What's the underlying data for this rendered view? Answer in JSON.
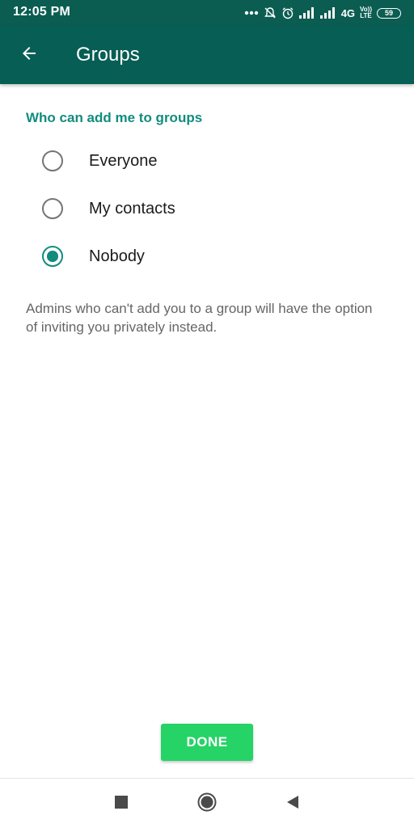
{
  "status_bar": {
    "time": "12:05 PM",
    "network": "4G",
    "volte_top": "Vo))",
    "volte_bottom": "LTE",
    "battery": "59"
  },
  "app_bar": {
    "title": "Groups",
    "back_icon": "arrow-left-icon"
  },
  "settings": {
    "section_header": "Who can add me to groups",
    "options": [
      {
        "label": "Everyone",
        "selected": false
      },
      {
        "label": "My contacts",
        "selected": false
      },
      {
        "label": "Nobody",
        "selected": true
      }
    ],
    "description": "Admins who can't add you to a group will have the option of inviting you privately instead."
  },
  "done_button": {
    "label": "DONE"
  },
  "nav_bar": {
    "icons": [
      "recents-square-icon",
      "home-circle-icon",
      "back-triangle-icon"
    ]
  },
  "colors": {
    "status_bar": "#0b5d52",
    "app_bar": "#075e54",
    "accent": "#128c7e",
    "done_button": "#25d366"
  }
}
